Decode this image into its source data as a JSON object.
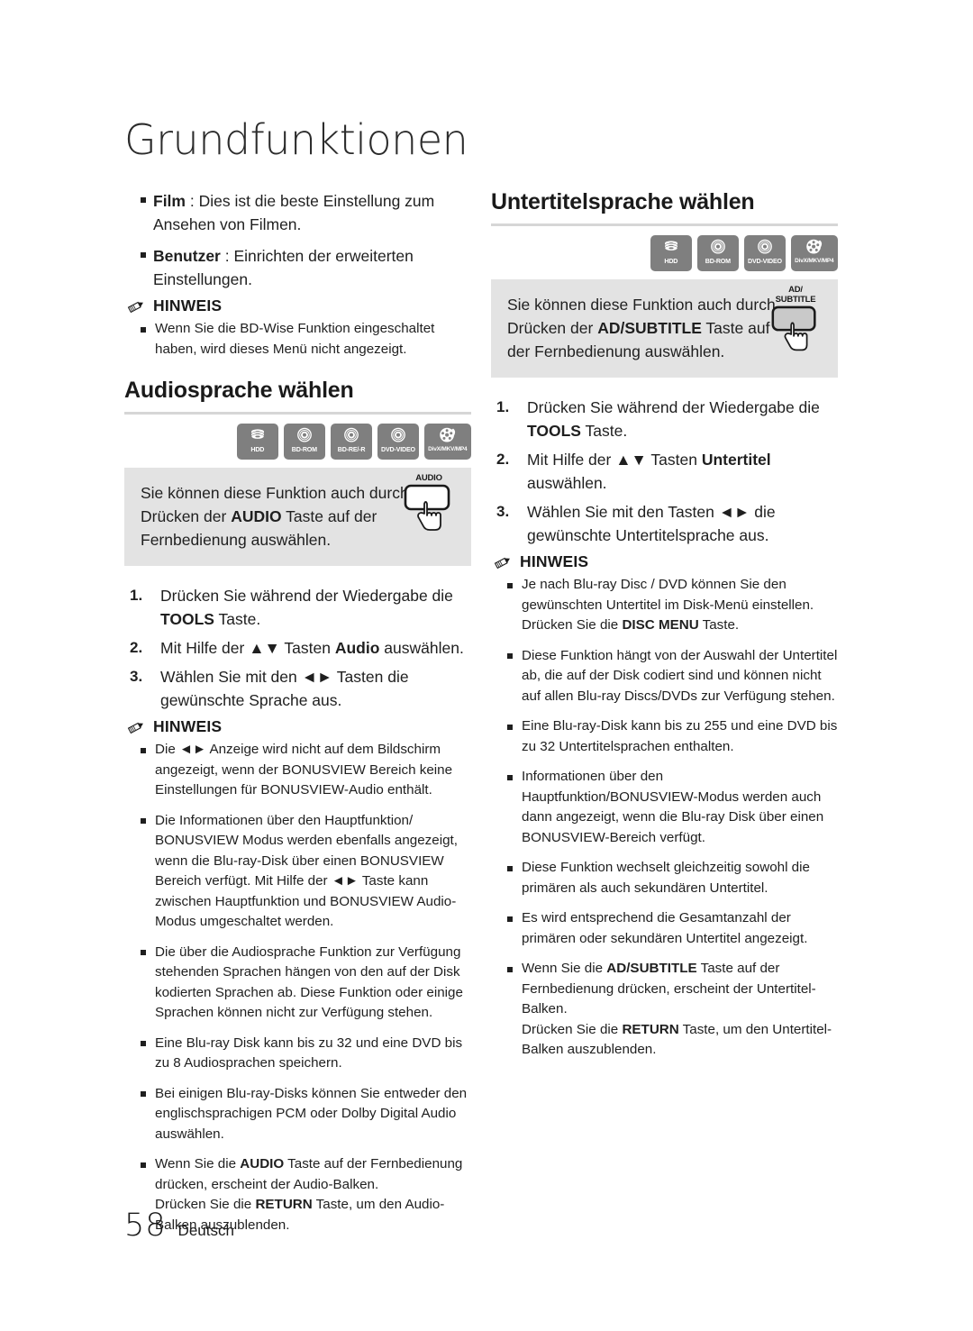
{
  "chapter_title": "Grundfunktionen",
  "footer": {
    "page_number": "58",
    "language": "Deutsch"
  },
  "note_label": "HINWEIS",
  "left_column": {
    "intro_bullets": [
      {
        "term": "Film",
        "text": " : Dies ist die beste Einstellung zum Ansehen von Filmen."
      },
      {
        "term": "Benutzer",
        "text": " : Einrichten der erweiterten Einstellungen."
      }
    ],
    "intro_note": "Wenn Sie die BD-Wise Funktion eingeschaltet haben, wird dieses Menü nicht angezeigt.",
    "section": {
      "heading": "Audiosprache wählen",
      "badges": [
        {
          "label": "HDD",
          "icon": "hdd-icon"
        },
        {
          "label": "BD-ROM",
          "icon": "disc-icon"
        },
        {
          "label": "BD-RE/-R",
          "icon": "disc-icon"
        },
        {
          "label": "DVD-VIDEO",
          "icon": "disc-icon"
        },
        {
          "label": "DivX/MKV/MP4",
          "icon": "film-reel-icon"
        }
      ],
      "callout": {
        "text_before": "Sie können diese Funktion auch durch Drücken der ",
        "bold": "AUDIO",
        "text_after": " Taste auf der Fernbedienung auswählen.",
        "button_label": "AUDIO"
      },
      "steps": [
        {
          "num": "1.",
          "before": "Drücken Sie während der Wiedergabe die ",
          "bold": "TOOLS",
          "after": " Taste."
        },
        {
          "num": "2.",
          "before": "Mit Hilfe der ▲▼ Tasten ",
          "bold": "Audio",
          "after": " auswählen."
        },
        {
          "num": "3.",
          "before": "Wählen Sie mit den ◄► Tasten die gewünschte Sprache aus.",
          "bold": "",
          "after": ""
        }
      ],
      "notes": [
        "Die ◄► Anzeige wird nicht auf dem Bildschirm angezeigt, wenn der BONUSVIEW Bereich keine Einstellungen für BONUSVIEW-Audio enthält.",
        "Die Informationen über den Hauptfunktion/ BONUSVIEW Modus werden ebenfalls angezeigt, wenn die Blu-ray-Disk über einen BONUSVIEW Bereich verfügt. Mit Hilfe der ◄► Taste kann zwischen Hauptfunktion und BONUSVIEW Audio-Modus umgeschaltet werden.",
        "Die über die Audiosprache Funktion zur Verfügung stehenden Sprachen hängen von den auf der Disk kodierten Sprachen ab. Diese Funktion oder einige Sprachen können nicht zur Verfügung stehen.",
        "Eine Blu-ray Disk kann bis zu 32 und eine DVD bis zu 8 Audiosprachen speichern.",
        "Bei einigen Blu-ray-Disks können Sie entweder den englischsprachigen PCM oder Dolby Digital Audio auswählen."
      ],
      "last_note": {
        "part1_before": "Wenn Sie die ",
        "part1_bold": "AUDIO",
        "part1_after": " Taste auf der Fernbedienung drücken, erscheint der Audio-Balken.",
        "part2_before": "Drücken Sie die ",
        "part2_bold": "RETURN",
        "part2_after": " Taste, um den Audio-Balken auszublenden."
      }
    }
  },
  "right_column": {
    "section": {
      "heading": "Untertitelsprache wählen",
      "badges": [
        {
          "label": "HDD",
          "icon": "hdd-icon"
        },
        {
          "label": "BD-ROM",
          "icon": "disc-icon"
        },
        {
          "label": "DVD-VIDEO",
          "icon": "disc-icon"
        },
        {
          "label": "DivX/MKV/MP4",
          "icon": "film-reel-icon"
        }
      ],
      "callout": {
        "text_before": "Sie können diese Funktion auch durch Drücken der ",
        "bold": "AD/SUBTITLE",
        "text_after": " Taste auf der Fernbedienung auswählen.",
        "button_label_line1": "AD/",
        "button_label_line2": "SUBTITLE"
      },
      "steps": [
        {
          "num": "1.",
          "before": "Drücken Sie während der Wiedergabe die ",
          "bold": "TOOLS",
          "after": " Taste."
        },
        {
          "num": "2.",
          "before": "Mit Hilfe der ▲▼ Tasten ",
          "bold": "Untertitel",
          "after": " auswählen."
        },
        {
          "num": "3.",
          "before": "Wählen Sie mit den Tasten ◄► die gewünschte Untertitelsprache aus.",
          "bold": "",
          "after": ""
        }
      ],
      "notes_with_bold": [
        {
          "before": "Je nach Blu-ray Disc / DVD können Sie den gewünschten Untertitel im Disk-Menü einstellen. Drücken Sie die ",
          "bold": "DISC MENU",
          "after": " Taste."
        }
      ],
      "notes": [
        "Diese Funktion hängt von der Auswahl der Untertitel ab, die auf der Disk codiert sind und können nicht auf allen Blu-ray Discs/DVDs zur Verfügung stehen.",
        "Eine Blu-ray-Disk kann bis zu 255 und eine DVD bis zu 32 Untertitelsprachen enthalten.",
        "Informationen über den Hauptfunktion/BONUSVIEW-Modus werden auch dann angezeigt, wenn die Blu-ray Disk über einen BONUSVIEW-Bereich verfügt.",
        "Diese Funktion wechselt gleichzeitig sowohl die primären als auch sekundären Untertitel.",
        "Es wird entsprechend die Gesamtanzahl der primären oder sekundären Untertitel angezeigt."
      ],
      "last_note": {
        "part1_before": "Wenn Sie die ",
        "part1_bold": "AD/SUBTITLE",
        "part1_after": " Taste auf der Fernbedienung drücken, erscheint der Untertitel-Balken.",
        "part2_before": "Drücken Sie die ",
        "part2_bold": "RETURN",
        "part2_after": " Taste, um den Untertitel-Balken auszublenden."
      }
    }
  }
}
